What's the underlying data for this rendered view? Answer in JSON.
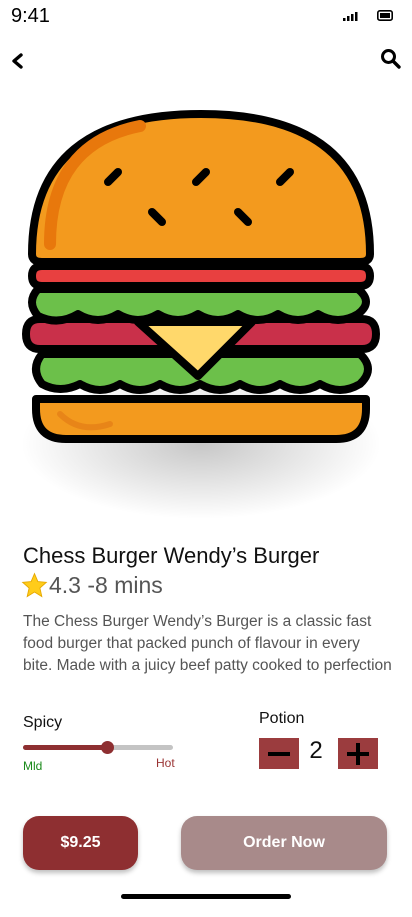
{
  "status_bar": {
    "time": "9:41"
  },
  "header": {
    "back_icon": "chevron-left-icon",
    "search_icon": "search-icon"
  },
  "product": {
    "image": "burger-illustration",
    "title": "Chess Burger Wendy’s Burger",
    "rating_icon": "star-icon",
    "rating_text": "4.3 -8 mins",
    "description": "The Chess Burger Wendy’s Burger is a classic fast food burger that packed punch of flavour in every bite. Made with a juicy beef patty cooked to perfection"
  },
  "spicy": {
    "label": "Spicy",
    "level": 0.56,
    "min_label": "Mld",
    "max_label": "Hot"
  },
  "portion": {
    "label": "Potion",
    "quantity": "2"
  },
  "actions": {
    "price_label": "$9.25",
    "order_label": "Order Now"
  },
  "colors": {
    "accent": "#8e2f31",
    "qty_button": "#9b3c3e",
    "order_button": "#a88a8a",
    "mild": "#1a8a1a",
    "hot": "#9a3434"
  }
}
